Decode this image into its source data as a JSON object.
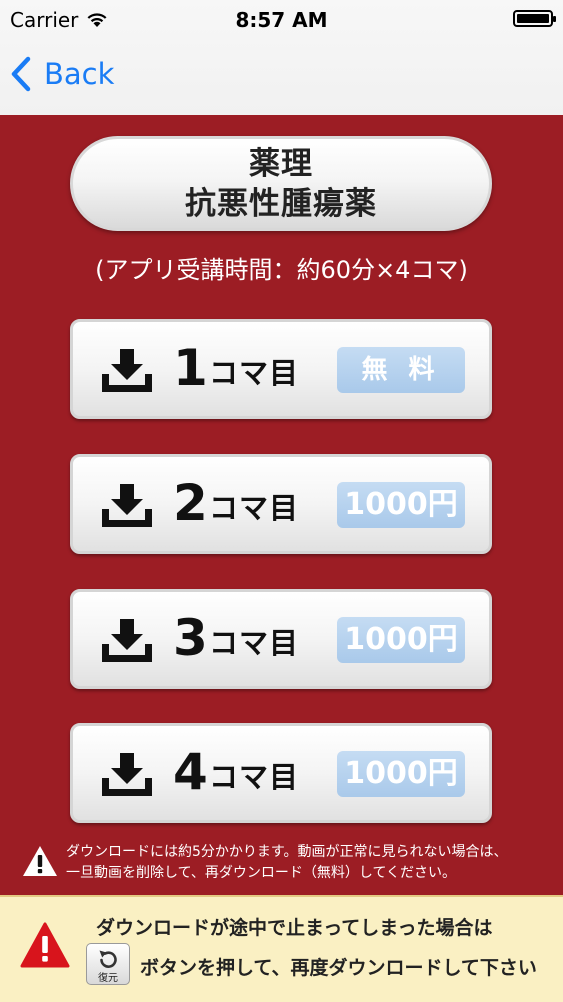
{
  "status_bar": {
    "carrier": "Carrier",
    "time": "8:57 AM"
  },
  "nav": {
    "back_label": "Back"
  },
  "title": {
    "line1": "薬理",
    "line2": "抗悪性腫瘍薬"
  },
  "subtitle": "(アプリ受講時間：約60分×4コマ)",
  "downloads": [
    {
      "number": "1",
      "label": "コマ目",
      "price": "無 料"
    },
    {
      "number": "2",
      "label": "コマ目",
      "price": "1000円"
    },
    {
      "number": "3",
      "label": "コマ目",
      "price": "1000円"
    },
    {
      "number": "4",
      "label": "コマ目",
      "price": "1000円"
    }
  ],
  "notice": {
    "line1": "ダウンロードには約5分かかります。動画が正常に見られない場合は、",
    "line2": "一旦動画を削除して、再ダウンロード（無料）してください。"
  },
  "banner": {
    "line1": "ダウンロードが途中で止まってしまった場合は",
    "restore_label": "復元",
    "line2": "ボタンを押して、再度ダウンロードして下さい"
  },
  "colors": {
    "background": "#9c1d24",
    "accent": "#1a7cf5",
    "price_badge": "#b6d2ee",
    "banner": "#faf0c3"
  }
}
